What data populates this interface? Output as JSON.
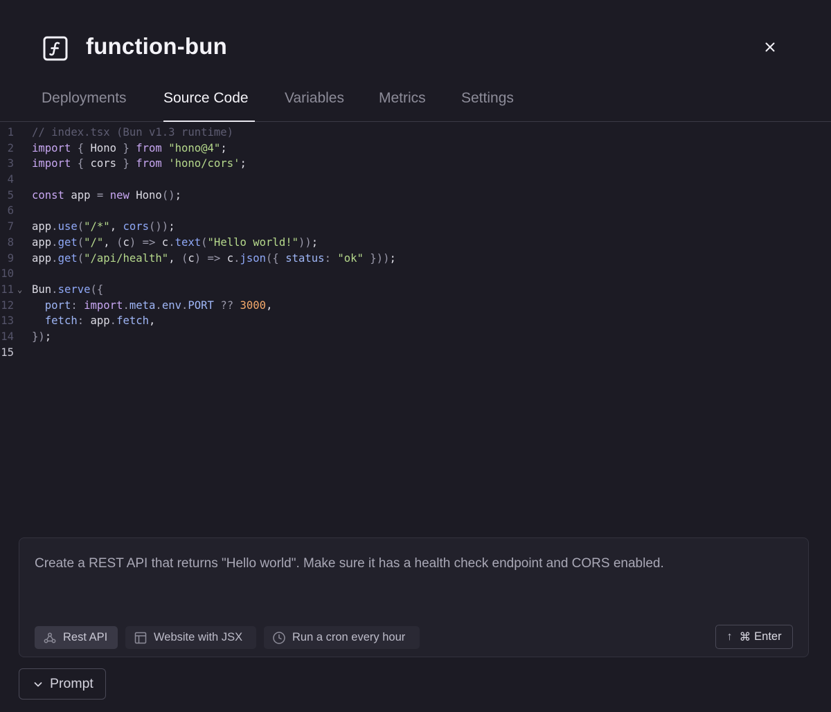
{
  "header": {
    "title": "function-bun",
    "icon": "function-icon",
    "close_icon": "close-icon"
  },
  "tabs": [
    {
      "label": "Deployments",
      "active": false
    },
    {
      "label": "Source Code",
      "active": true
    },
    {
      "label": "Variables",
      "active": false
    },
    {
      "label": "Metrics",
      "active": false
    },
    {
      "label": "Settings",
      "active": false
    }
  ],
  "editor": {
    "active_line": 15,
    "lines": [
      {
        "n": "1",
        "tokens": [
          [
            "c",
            "// index.tsx (Bun v1.3 runtime)"
          ]
        ]
      },
      {
        "n": "2",
        "tokens": [
          [
            "k",
            "import"
          ],
          [
            "p",
            " { "
          ],
          [
            "t",
            "Hono"
          ],
          [
            "p",
            " } "
          ],
          [
            "k",
            "from"
          ],
          [
            "t",
            " "
          ],
          [
            "s",
            "\"hono@4\""
          ],
          [
            "t",
            ";"
          ]
        ]
      },
      {
        "n": "3",
        "tokens": [
          [
            "k",
            "import"
          ],
          [
            "p",
            " { "
          ],
          [
            "t",
            "cors"
          ],
          [
            "p",
            " } "
          ],
          [
            "k",
            "from"
          ],
          [
            "t",
            " "
          ],
          [
            "s",
            "'hono/cors'"
          ],
          [
            "t",
            ";"
          ]
        ]
      },
      {
        "n": "4",
        "tokens": []
      },
      {
        "n": "5",
        "tokens": [
          [
            "k",
            "const"
          ],
          [
            "t",
            " app "
          ],
          [
            "p",
            "="
          ],
          [
            "t",
            " "
          ],
          [
            "k",
            "new"
          ],
          [
            "t",
            " Hono"
          ],
          [
            "p",
            "()"
          ],
          [
            "t",
            ";"
          ]
        ]
      },
      {
        "n": "6",
        "tokens": []
      },
      {
        "n": "7",
        "tokens": [
          [
            "t",
            "app"
          ],
          [
            "p",
            "."
          ],
          [
            "f",
            "use"
          ],
          [
            "p",
            "("
          ],
          [
            "s",
            "\"/*\""
          ],
          [
            "t",
            ", "
          ],
          [
            "f",
            "cors"
          ],
          [
            "p",
            "())"
          ],
          [
            "t",
            ";"
          ]
        ]
      },
      {
        "n": "8",
        "tokens": [
          [
            "t",
            "app"
          ],
          [
            "p",
            "."
          ],
          [
            "f",
            "get"
          ],
          [
            "p",
            "("
          ],
          [
            "s",
            "\"/\""
          ],
          [
            "t",
            ", "
          ],
          [
            "p",
            "("
          ],
          [
            "t",
            "c"
          ],
          [
            "p",
            ")"
          ],
          [
            "t",
            " "
          ],
          [
            "p",
            "=>"
          ],
          [
            "t",
            " c"
          ],
          [
            "p",
            "."
          ],
          [
            "f",
            "text"
          ],
          [
            "p",
            "("
          ],
          [
            "s",
            "\"Hello world!\""
          ],
          [
            "p",
            "))"
          ],
          [
            "t",
            ";"
          ]
        ]
      },
      {
        "n": "9",
        "tokens": [
          [
            "t",
            "app"
          ],
          [
            "p",
            "."
          ],
          [
            "f",
            "get"
          ],
          [
            "p",
            "("
          ],
          [
            "s",
            "\"/api/health\""
          ],
          [
            "t",
            ", "
          ],
          [
            "p",
            "("
          ],
          [
            "t",
            "c"
          ],
          [
            "p",
            ")"
          ],
          [
            "t",
            " "
          ],
          [
            "p",
            "=>"
          ],
          [
            "t",
            " c"
          ],
          [
            "p",
            "."
          ],
          [
            "f",
            "json"
          ],
          [
            "p",
            "({ "
          ],
          [
            "r",
            "status"
          ],
          [
            "p",
            ":"
          ],
          [
            "t",
            " "
          ],
          [
            "s",
            "\"ok\""
          ],
          [
            "p",
            " }))"
          ],
          [
            "t",
            ";"
          ]
        ]
      },
      {
        "n": "10",
        "tokens": []
      },
      {
        "n": "11",
        "fold": true,
        "tokens": [
          [
            "t",
            "Bun"
          ],
          [
            "p",
            "."
          ],
          [
            "f",
            "serve"
          ],
          [
            "p",
            "({"
          ]
        ]
      },
      {
        "n": "12",
        "tokens": [
          [
            "r",
            "  port"
          ],
          [
            "p",
            ":"
          ],
          [
            "t",
            " "
          ],
          [
            "k",
            "import"
          ],
          [
            "p",
            "."
          ],
          [
            "r",
            "meta"
          ],
          [
            "p",
            "."
          ],
          [
            "r",
            "env"
          ],
          [
            "p",
            "."
          ],
          [
            "r",
            "PORT"
          ],
          [
            "t",
            " "
          ],
          [
            "p",
            "??"
          ],
          [
            "t",
            " "
          ],
          [
            "n",
            "3000"
          ],
          [
            "t",
            ","
          ]
        ]
      },
      {
        "n": "13",
        "tokens": [
          [
            "r",
            "  fetch"
          ],
          [
            "p",
            ":"
          ],
          [
            "t",
            " app"
          ],
          [
            "p",
            "."
          ],
          [
            "r",
            "fetch"
          ],
          [
            "t",
            ","
          ]
        ]
      },
      {
        "n": "14",
        "tokens": [
          [
            "p",
            "})"
          ],
          [
            "t",
            ";"
          ]
        ]
      },
      {
        "n": "15",
        "tokens": []
      }
    ]
  },
  "prompt": {
    "text": "Create a REST API that returns \"Hello world\". Make sure it has a health check endpoint and CORS enabled.",
    "chips": [
      {
        "label": "Rest API",
        "icon": "webhook-icon",
        "selected": true
      },
      {
        "label": "Website with JSX",
        "icon": "layout-icon",
        "selected": false
      },
      {
        "label": "Run a cron every hour",
        "icon": "clock-icon",
        "selected": false
      }
    ],
    "submit": {
      "arrow": "↑",
      "cmd": "⌘",
      "label": "Enter"
    },
    "toggle_label": "Prompt"
  }
}
